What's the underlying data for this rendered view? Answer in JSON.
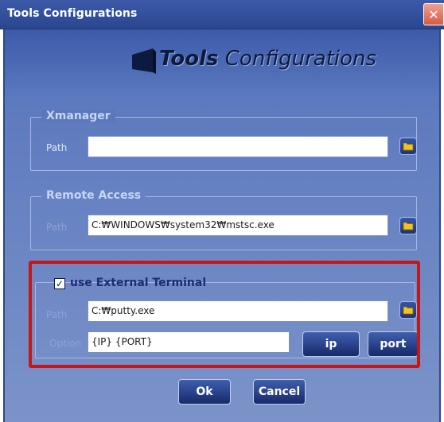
{
  "window": {
    "title": "Tools Configurations",
    "close_glyph": "✕"
  },
  "logo": {
    "bold_text": "Tools",
    "italic_text": " Configurations"
  },
  "xmanager": {
    "group_title": "Xmanager",
    "path_label": "Path",
    "path_value": ""
  },
  "remote_access": {
    "group_title": "Remote Access",
    "path_label": "Path",
    "path_value": "C:₩WINDOWS₩system32₩mstsc.exe"
  },
  "external_terminal": {
    "checkbox_label": "use External Terminal",
    "checked": true,
    "check_glyph": "✓",
    "path_label": "Path",
    "path_value": "C:₩putty.exe",
    "option_label": "Option",
    "option_value": "{IP}  {PORT}",
    "ip_button": "ip",
    "port_button": "port"
  },
  "footer": {
    "ok_button": "Ok",
    "cancel_button": "Cancel"
  },
  "colors": {
    "title_bar": "#3c5aa8",
    "body_bg": "#6681c2",
    "highlight_border": "#c41818",
    "button_bg": "#17296a"
  }
}
